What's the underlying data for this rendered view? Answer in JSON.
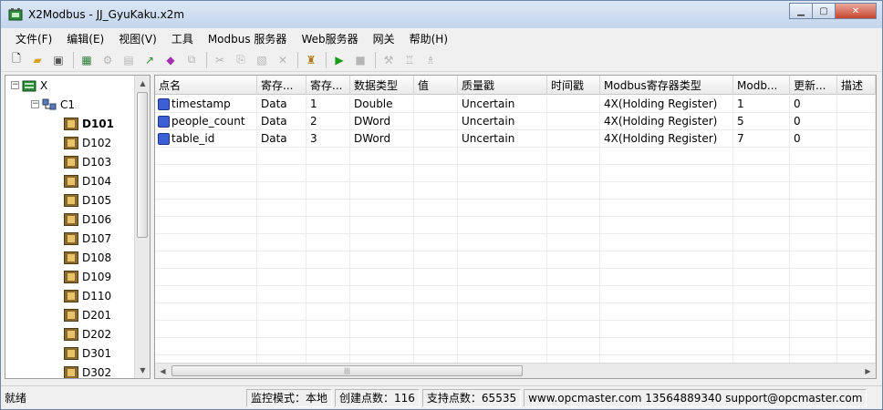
{
  "window": {
    "title": "X2Modbus - JJ_GyuKaku.x2m"
  },
  "menu": [
    "文件(F)",
    "编辑(E)",
    "视图(V)",
    "工具",
    "Modbus 服务器",
    "Web服务器",
    "网关",
    "帮助(H)"
  ],
  "tree": {
    "root": "X",
    "channel": "C1",
    "devices": [
      "D101",
      "D102",
      "D103",
      "D104",
      "D105",
      "D106",
      "D107",
      "D108",
      "D109",
      "D110",
      "D201",
      "D202",
      "D301",
      "D302"
    ],
    "selected": "D101"
  },
  "grid": {
    "columns": [
      "点名",
      "寄存...",
      "寄存...",
      "数据类型",
      "值",
      "质量戳",
      "时间戳",
      "Modbus寄存器类型",
      "Modb...",
      "更新...",
      "描述"
    ],
    "rows": [
      [
        "timestamp",
        "Data",
        "1",
        "Double",
        "",
        "Uncertain",
        "",
        "4X(Holding Register)",
        "1",
        "0",
        ""
      ],
      [
        "people_count",
        "Data",
        "2",
        "DWord",
        "",
        "Uncertain",
        "",
        "4X(Holding Register)",
        "5",
        "0",
        ""
      ],
      [
        "table_id",
        "Data",
        "3",
        "DWord",
        "",
        "Uncertain",
        "",
        "4X(Holding Register)",
        "7",
        "0",
        ""
      ]
    ]
  },
  "status": {
    "ready": "就绪",
    "mode": "监控模式：本地",
    "created": "创建点数：116",
    "supported": "支持点数：65535",
    "contact": "www.opcmaster.com 13564889340 support@opcmaster.com"
  },
  "colors": {
    "tag_icon": "#3b5fd4",
    "device_icon": "#8b6a2f",
    "close_button": "#c7452e"
  }
}
